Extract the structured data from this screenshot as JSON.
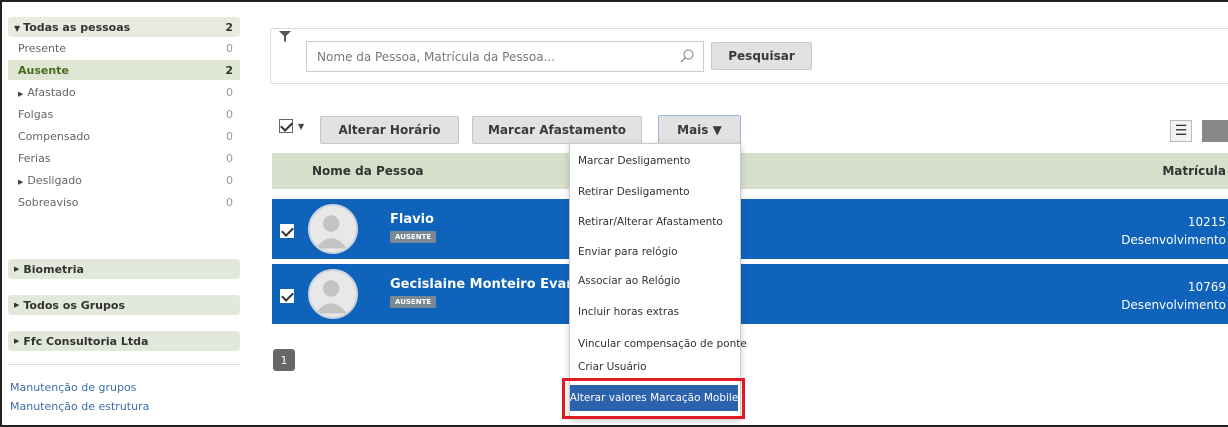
{
  "sidebar": {
    "all": {
      "label": "Todas as pessoas",
      "count": "2"
    },
    "items": [
      {
        "label": "Presente",
        "count": "0"
      },
      {
        "label": "Ausente",
        "count": "2"
      },
      {
        "label": "Afastado",
        "count": "0"
      },
      {
        "label": "Folgas",
        "count": "0"
      },
      {
        "label": "Compensado",
        "count": "0"
      },
      {
        "label": "Ferias",
        "count": "0"
      },
      {
        "label": "Desligado",
        "count": "0"
      },
      {
        "label": "Sobreaviso",
        "count": "0"
      }
    ],
    "groups": [
      "Biometria",
      "Todos os Grupos",
      "Ffc Consultoria Ltda"
    ],
    "links": [
      "Manutenção de grupos",
      "Manutenção de estrutura"
    ]
  },
  "search": {
    "placeholder": "Nome da Pessoa, Matrícula da Pessoa...",
    "button": "Pesquisar"
  },
  "toolbar": {
    "alterar_horario": "Alterar Horário",
    "marcar_afastamento": "Marcar Afastamento",
    "mais": "Mais ▼"
  },
  "table": {
    "col_nome": "Nome da Pessoa",
    "col_matricula": "Matrícula",
    "rows": [
      {
        "name": "Flavio",
        "status": "AUSENTE",
        "matricula": "10215",
        "departamento": "Desenvolvimento"
      },
      {
        "name": "Gecislaine Monteiro Evangelis",
        "status": "AUSENTE",
        "matricula": "10769",
        "departamento": "Desenvolvimento"
      }
    ]
  },
  "pagination": {
    "page": "1"
  },
  "menu": {
    "items": [
      "Marcar Desligamento",
      "Retirar Desligamento",
      "Retirar/Alterar Afastamento",
      "Enviar para relógio",
      "Associar ao Relógio",
      "Incluir horas extras",
      "Vincular compensação de ponte",
      "Criar Usuário"
    ],
    "highlighted": "Alterar valores Marcação Mobile"
  },
  "colors": {
    "row_selected": "#0f63bb",
    "header_bg": "#d6dfc9",
    "highlight_box": "#e01b24",
    "menu_highlight": "#2d62ad"
  }
}
